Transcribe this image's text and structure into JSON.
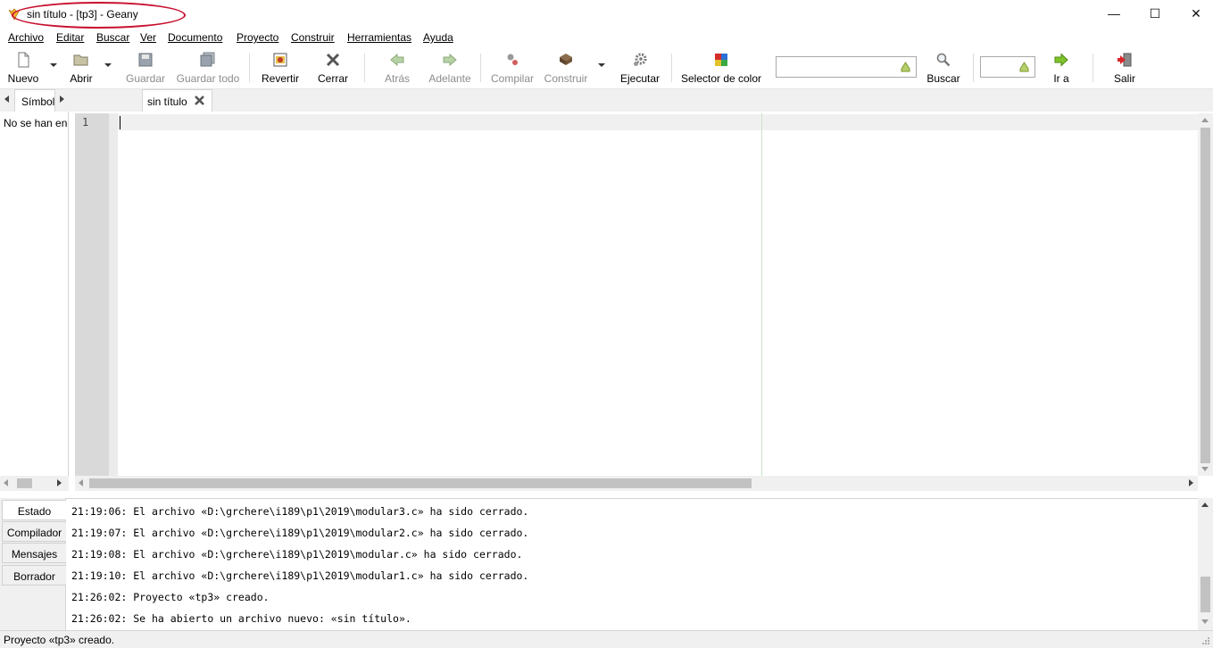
{
  "window": {
    "title": "sin título - [tp3] - Geany",
    "minimize": "—",
    "maximize": "☐",
    "close": "✕"
  },
  "menu": [
    "Archivo",
    "Editar",
    "Buscar",
    "Ver",
    "Documento",
    "Proyecto",
    "Construir",
    "Herramientas",
    "Ayuda"
  ],
  "toolbar": {
    "new": "Nuevo",
    "open": "Abrir",
    "save": "Guardar",
    "save_all": "Guardar todo",
    "revert": "Revertir",
    "close": "Cerrar",
    "back": "Atrás",
    "forward": "Adelante",
    "compile": "Compilar",
    "build": "Construir",
    "run": "Ejecutar",
    "color": "Selector de color",
    "search": "Buscar",
    "goto": "Ir a",
    "quit": "Salir"
  },
  "sidebar": {
    "tab": "Símbolos",
    "message": "No se han encontrado símbolos"
  },
  "editor": {
    "tab": "sin título",
    "line_number": "1"
  },
  "messages": {
    "tabs": [
      "Estado",
      "Compilador",
      "Mensajes",
      "Borrador"
    ],
    "lines": [
      "21:19:06: El archivo «D:\\grchere\\i189\\p1\\2019\\modular3.c» ha sido cerrado.",
      "21:19:07: El archivo «D:\\grchere\\i189\\p1\\2019\\modular2.c» ha sido cerrado.",
      "21:19:08: El archivo «D:\\grchere\\i189\\p1\\2019\\modular.c» ha sido cerrado.",
      "21:19:10: El archivo «D:\\grchere\\i189\\p1\\2019\\modular1.c» ha sido cerrado.",
      "21:26:02: Proyecto «tp3» creado.",
      "21:26:02: Se ha abierto un archivo nuevo: «sin título»."
    ]
  },
  "status": "Proyecto «tp3» creado.",
  "colors": {
    "annotation": "#c8102e",
    "long_line_marker": "#c8e3c8"
  }
}
